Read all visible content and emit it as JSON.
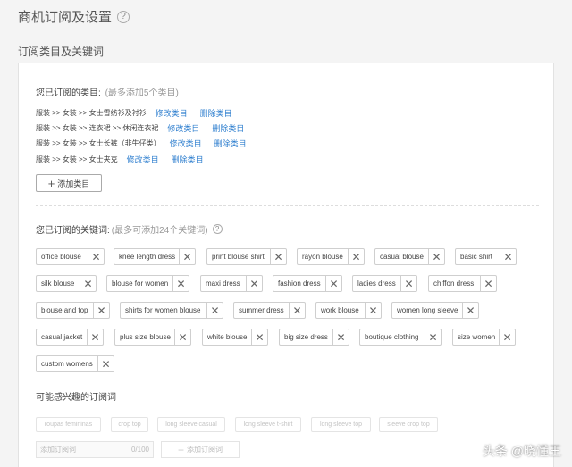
{
  "page": {
    "title": "商机订阅及设置",
    "help_icon": "?"
  },
  "subscription": {
    "section_title": "订阅类目及关键词"
  },
  "categories": {
    "label": "您已订阅的类目:",
    "hint": "(最多添加5个类目)",
    "items": [
      {
        "path": "服装 >> 女装 >> 女士雪纺衫及衬衫",
        "edit": "修改类目",
        "delete": "删除类目"
      },
      {
        "path": "服装 >> 女装 >> 连衣裙 >> 休闲连衣裙",
        "edit": "修改类目",
        "delete": "删除类目"
      },
      {
        "path": "服装 >> 女装 >> 女士长裤（非牛仔类）",
        "edit": "修改类目",
        "delete": "删除类目"
      },
      {
        "path": "服装 >> 女装 >> 女士夹克",
        "edit": "修改类目",
        "delete": "删除类目"
      }
    ],
    "add_button": "添加类目"
  },
  "keywords": {
    "label": "您已订阅的关键词:",
    "hint": "(最多可添加24个关键词)",
    "help_icon": "?",
    "tags": [
      "office blouse",
      "knee length dress",
      "print blouse shirt",
      "rayon blouse",
      "casual blouse",
      "basic shirt",
      "silk blouse",
      "blouse for women",
      "maxi dress",
      "fashion dress",
      "ladies dress",
      "chiffon dress",
      "blouse and top",
      "shirts for women blouse",
      "summer dress",
      "work blouse",
      "women long sleeve",
      "casual jacket",
      "plus size blouse",
      "white blouse",
      "big size dress",
      "boutique clothing",
      "size women",
      "custom womens"
    ],
    "remove_icon": "✕"
  },
  "suggestions": {
    "label": "可能感兴趣的订阅词",
    "tags": [
      "roupas femininas",
      "crop top",
      "long sleeve casual",
      "long sleeve t-shirt",
      "long sleeve top",
      "sleeve crop top"
    ]
  },
  "add_keyword": {
    "placeholder": "添加订阅词",
    "counter": "0/100",
    "button": "添加订阅词"
  },
  "watermark": "头条 @晓懂王"
}
